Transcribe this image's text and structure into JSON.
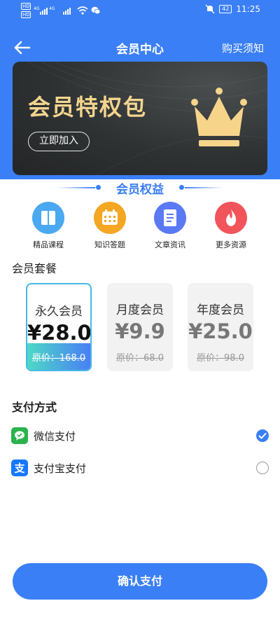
{
  "status_bar": {
    "hd1": "HD",
    "hd2": "HD",
    "net1": "4G",
    "net2": "4G",
    "battery": "42",
    "time": "11:25"
  },
  "nav": {
    "back_icon": "arrow-left-icon",
    "title": "会员中心",
    "notice": "购买须知"
  },
  "banner": {
    "title": "会员特权包",
    "join_label": "立即加入",
    "icon": "crown-icon",
    "title_color": "#f3d58e"
  },
  "benefits": {
    "title": "会员权益",
    "items": [
      {
        "label": "精品课程",
        "icon": "book-icon",
        "color": "#4aa9f0"
      },
      {
        "label": "知识答题",
        "icon": "calendar-icon",
        "color": "#f5a623"
      },
      {
        "label": "文章资讯",
        "icon": "document-icon",
        "color": "#5a79f4"
      },
      {
        "label": "更多资源",
        "icon": "flame-icon",
        "color": "#f2545b"
      }
    ]
  },
  "packages": {
    "title": "会员套餐",
    "items": [
      {
        "name": "永久会员",
        "price": "¥28.0",
        "original": "原价：168.0",
        "selected": true
      },
      {
        "name": "月度会员",
        "price": "¥9.9",
        "original": "原价：68.0",
        "selected": false
      },
      {
        "name": "年度会员",
        "price": "¥25.0",
        "original": "原价：98.0",
        "selected": false
      }
    ]
  },
  "payment": {
    "title": "支付方式",
    "methods": [
      {
        "label": "微信支付",
        "icon": "wechat-pay-icon",
        "color": "#2bb24c",
        "checked": true
      },
      {
        "label": "支付宝支付",
        "icon": "alipay-icon",
        "color": "#1677ff",
        "checked": false
      }
    ]
  },
  "confirm_label": "确认支付",
  "colors": {
    "primary": "#3a7ff5",
    "accent_gradient_start": "#4dd9c5"
  }
}
